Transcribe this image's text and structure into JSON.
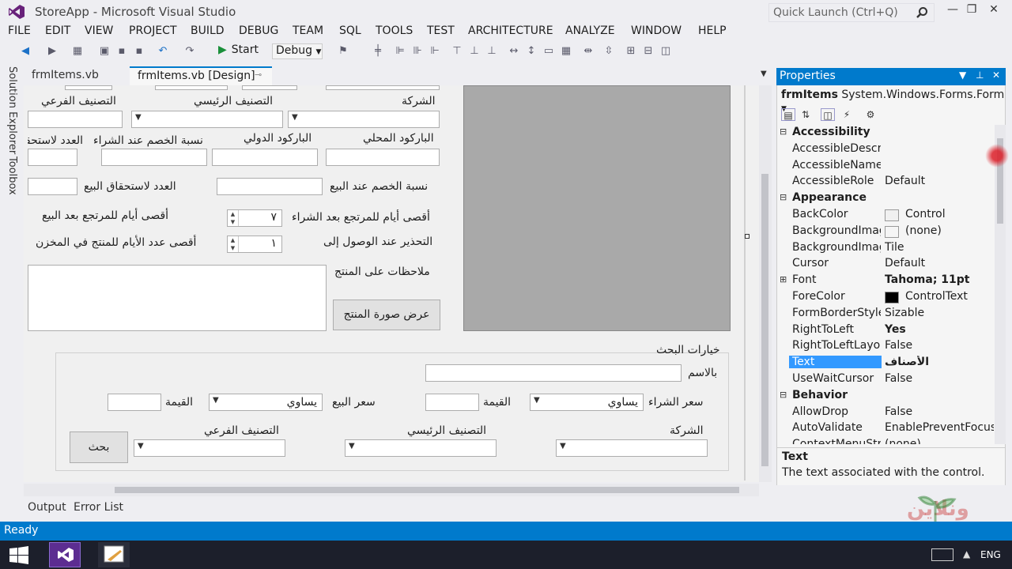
{
  "window": {
    "title": "StoreApp - Microsoft Visual Studio",
    "quick_launch": "Quick Launch (Ctrl+Q)"
  },
  "menu": [
    "FILE",
    "EDIT",
    "VIEW",
    "PROJECT",
    "BUILD",
    "DEBUG",
    "TEAM",
    "SQL",
    "TOOLS",
    "TEST",
    "ARCHITECTURE",
    "ANALYZE",
    "WINDOW",
    "HELP"
  ],
  "toolbar": {
    "start_label": "Start",
    "config": "Debug"
  },
  "side_tabs": [
    "Solution Explorer",
    "Toolbox"
  ],
  "doc_tabs": {
    "tab1": "frmItems.vb",
    "tab2": "frmItems.vb [Design]"
  },
  "form": {
    "company_label": "الشركة",
    "main_category_label": "التصنيف الرئيسي",
    "sub_category_label": "التصنيف الفرعي",
    "local_barcode_label": "الباركود المحلي",
    "intl_barcode_label": "الباركود الدولي",
    "purchase_discount_label": "نسبة الخصم عند الشراء",
    "count_purchase_label": "العدد لاستحقاق",
    "sale_discount_label": "نسبة الخصم عند البيع",
    "count_sale_label": "العدد لاستحقاق البيع",
    "max_return_purchase_label": "أقصى أيام للمرتجع بعد الشراء",
    "max_return_purchase_value": "٧",
    "max_return_sale_label": "أقصى أيام للمرتجع بعد البيع",
    "alert_label": "التحذير عند الوصول إلى",
    "alert_value": "١",
    "max_days_store_label": "أقصى عدد الأيام للمنتج في المخزن",
    "notes_label": "ملاحظات على المنتج",
    "show_image_button": "عرض صورة المنتج"
  },
  "search": {
    "group_title": "خيارات البحث",
    "by_name_label": "بالاسم",
    "purchase_price_label": "سعر الشراء",
    "purchase_op": "يساوي",
    "value_label": "القيمة",
    "sale_price_label": "سعر البيع",
    "sale_op": "يساوي",
    "company_label": "الشركة",
    "main_category_label": "التصنيف الرئيسي",
    "sub_category_label": "التصنيف الفرعي",
    "search_button": "بحث"
  },
  "bottom_tabs": {
    "output": "Output",
    "error_list": "Error List"
  },
  "properties": {
    "title": "Properties",
    "object_name": "frmItems",
    "object_type": "System.Windows.Forms.Form",
    "rows": [
      {
        "name": "Accessibility",
        "category": true
      },
      {
        "name": "AccessibleDescription",
        "value": ""
      },
      {
        "name": "AccessibleName",
        "value": ""
      },
      {
        "name": "AccessibleRole",
        "value": "Default"
      },
      {
        "name": "Appearance",
        "category": true
      },
      {
        "name": "BackColor",
        "value": "Control",
        "swatch": "#f0f0f0"
      },
      {
        "name": "BackgroundImage",
        "value": "(none)",
        "swatch": "#f5f5f5"
      },
      {
        "name": "BackgroundImageLayout",
        "value": "Tile"
      },
      {
        "name": "Cursor",
        "value": "Default"
      },
      {
        "name": "Font",
        "value": "Tahoma; 11pt",
        "bold": true,
        "expandable": true
      },
      {
        "name": "ForeColor",
        "value": "ControlText",
        "swatch": "#000000"
      },
      {
        "name": "FormBorderStyle",
        "value": "Sizable"
      },
      {
        "name": "RightToLeft",
        "value": "Yes",
        "bold": true
      },
      {
        "name": "RightToLeftLayout",
        "value": "False"
      },
      {
        "name": "Text",
        "value": "الأصناف",
        "bold": true,
        "selected": true
      },
      {
        "name": "UseWaitCursor",
        "value": "False"
      },
      {
        "name": "Behavior",
        "category": true
      },
      {
        "name": "AllowDrop",
        "value": "False"
      },
      {
        "name": "AutoValidate",
        "value": "EnablePreventFocusChange"
      },
      {
        "name": "ContextMenuStrip",
        "value": "(none)"
      }
    ],
    "desc_title": "Text",
    "desc_text": "The text associated with the control."
  },
  "status": {
    "text": "Ready"
  },
  "taskbar": {
    "lang": "ENG"
  },
  "watermark_text": "وقف أونلاين",
  "colors": {
    "accent": "#007acc",
    "vs_purple": "#68217a",
    "picture_box": "#a9a9a9"
  }
}
